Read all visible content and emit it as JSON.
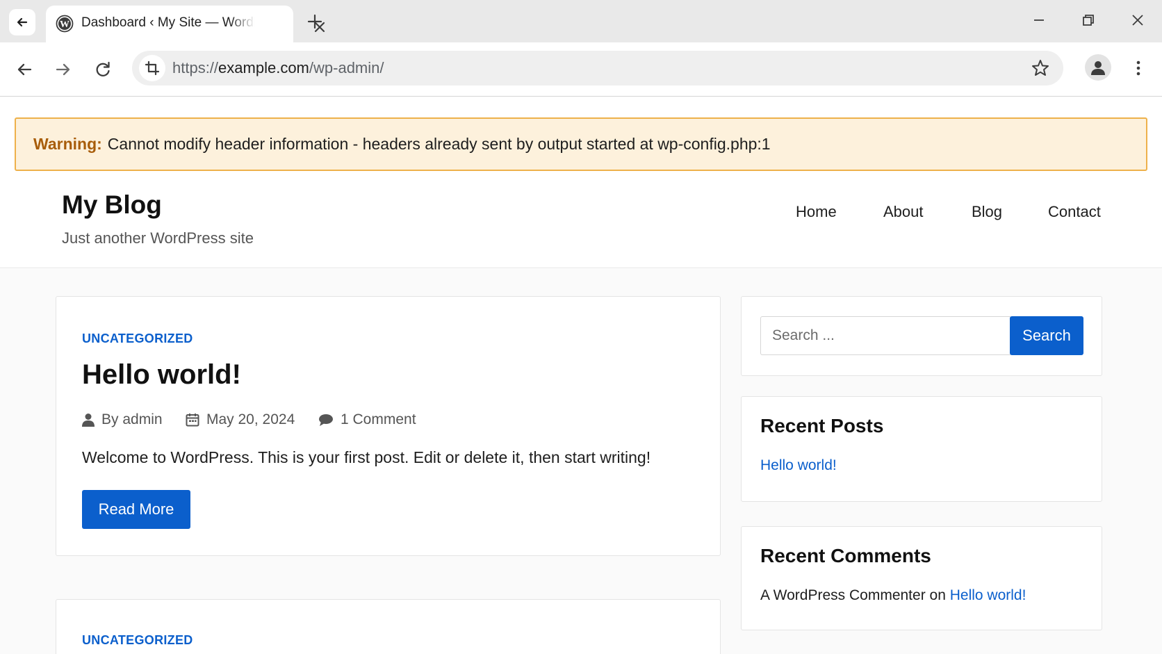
{
  "browser": {
    "tab_title": "Dashboard ‹ My Site — WordPress",
    "url_scheme": "https://",
    "url_host": "example.com",
    "url_path": "/wp-admin/"
  },
  "warning": {
    "label": "Warning:",
    "message": "Cannot modify header information - headers already sent by output started at wp-config.php:1"
  },
  "site": {
    "title": "My Blog",
    "tagline": "Just another WordPress site"
  },
  "nav": {
    "items": [
      {
        "label": "Home"
      },
      {
        "label": "About"
      },
      {
        "label": "Blog"
      },
      {
        "label": "Contact"
      }
    ]
  },
  "posts": [
    {
      "category": "UNCATEGORIZED",
      "title": "Hello world!",
      "author": "By admin",
      "date": "May 20, 2024",
      "comments": "1 Comment",
      "excerpt": "Welcome to WordPress. This is your first post. Edit or delete it, then start writing!",
      "read_more": "Read More"
    },
    {
      "category": "UNCATEGORIZED"
    }
  ],
  "sidebar": {
    "search": {
      "placeholder": "Search ...",
      "button": "Search"
    },
    "recent_posts": {
      "title": "Recent Posts",
      "items": [
        {
          "label": "Hello world!"
        }
      ]
    },
    "recent_comments": {
      "title": "Recent Comments",
      "commenter": "A WordPress Commenter",
      "on_word": "on",
      "post_link": "Hello world!"
    }
  },
  "colors": {
    "accent": "#0b5fcc",
    "warning_bg": "#fdf1dc",
    "warning_border": "#eeb14a",
    "warning_label": "#a85d0b"
  }
}
